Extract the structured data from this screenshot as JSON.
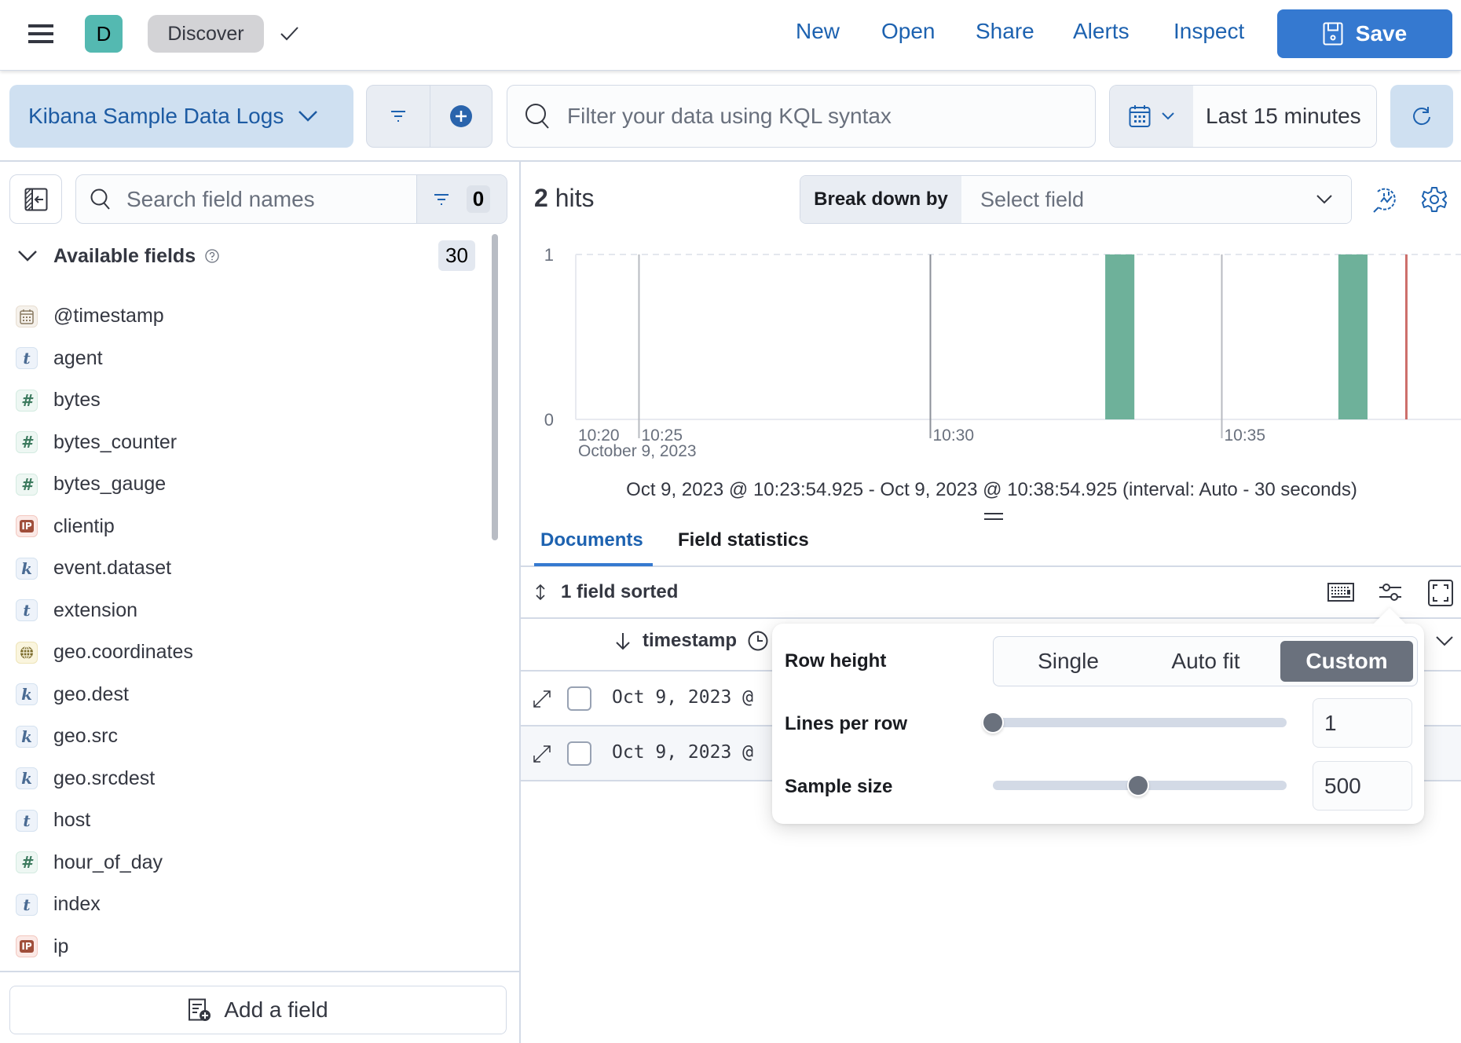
{
  "header": {
    "menu_icon": "hamburger-icon",
    "space_avatar": "D",
    "app_name": "Discover",
    "nav": [
      "New",
      "Open",
      "Share",
      "Alerts",
      "Inspect"
    ],
    "save_label": "Save"
  },
  "query_bar": {
    "data_view": "Kibana Sample Data Logs",
    "kql_placeholder": "Filter your data using KQL syntax",
    "kql_value": "",
    "time_range": "Last 15 minutes"
  },
  "sidebar": {
    "search_placeholder": "Search field names",
    "search_value": "",
    "filter_count": "0",
    "available_fields_label": "Available fields",
    "available_fields_count": "30",
    "fields": [
      {
        "name": "@timestamp",
        "type": "date"
      },
      {
        "name": "agent",
        "type": "t"
      },
      {
        "name": "bytes",
        "type": "number"
      },
      {
        "name": "bytes_counter",
        "type": "number"
      },
      {
        "name": "bytes_gauge",
        "type": "number"
      },
      {
        "name": "clientip",
        "type": "ip"
      },
      {
        "name": "event.dataset",
        "type": "k"
      },
      {
        "name": "extension",
        "type": "t"
      },
      {
        "name": "geo.coordinates",
        "type": "geo"
      },
      {
        "name": "geo.dest",
        "type": "k"
      },
      {
        "name": "geo.src",
        "type": "k"
      },
      {
        "name": "geo.srcdest",
        "type": "k"
      },
      {
        "name": "host",
        "type": "t"
      },
      {
        "name": "hour_of_day",
        "type": "number"
      },
      {
        "name": "index",
        "type": "t"
      },
      {
        "name": "ip",
        "type": "ip"
      }
    ],
    "type_glyphs": {
      "t": "t",
      "k": "k",
      "number": "#",
      "ip": "IP"
    },
    "add_field_label": "Add a field"
  },
  "main": {
    "hits_count": "2",
    "hits_label": "hits",
    "breakdown_label": "Break down by",
    "breakdown_placeholder": "Select field",
    "range_text": "Oct 9, 2023 @ 10:23:54.925 - Oct 9, 2023 @ 10:38:54.925 (interval: Auto - 30 seconds)",
    "tabs": [
      {
        "label": "Documents",
        "active": true
      },
      {
        "label": "Field statistics",
        "active": false
      }
    ],
    "sorted_label": "1 field sorted",
    "column_header": "timestamp",
    "rows": [
      {
        "timestamp": "Oct 9, 2023 @"
      },
      {
        "timestamp": "Oct 9, 2023 @"
      }
    ]
  },
  "display_popover": {
    "row_height_label": "Row height",
    "row_height_options": [
      "Single",
      "Auto fit",
      "Custom"
    ],
    "row_height_selected": "Custom",
    "lines_per_row_label": "Lines per row",
    "lines_per_row_value": "1",
    "lines_per_row_range": [
      1,
      20
    ],
    "sample_size_label": "Sample size",
    "sample_size_value": "500",
    "sample_size_range": [
      10,
      1000
    ]
  },
  "colors": {
    "primary": "#3579d0",
    "link": "#1d62b0",
    "bar": "#6eb19a",
    "now_line": "#cc6e6a"
  },
  "chart_data": {
    "type": "bar",
    "title": "",
    "xlabel": "",
    "ylabel": "",
    "x_domain": [
      "10:23:54.925",
      "10:38:54.925"
    ],
    "ylim": [
      0,
      1
    ],
    "y_ticks": [
      "0",
      "1"
    ],
    "x_ticks": [
      "10:20",
      "10:25",
      "10:30",
      "10:35"
    ],
    "x_tick_minutes": [
      20,
      25,
      30,
      35
    ],
    "date_label": "October 9, 2023",
    "interval_seconds": 30,
    "bars": [
      {
        "start": "10:33:00",
        "end": "10:33:30",
        "value": 1
      },
      {
        "start": "10:37:00",
        "end": "10:37:30",
        "value": 1
      }
    ],
    "now_marker": "10:38:10",
    "grid": true,
    "legend": "none"
  }
}
